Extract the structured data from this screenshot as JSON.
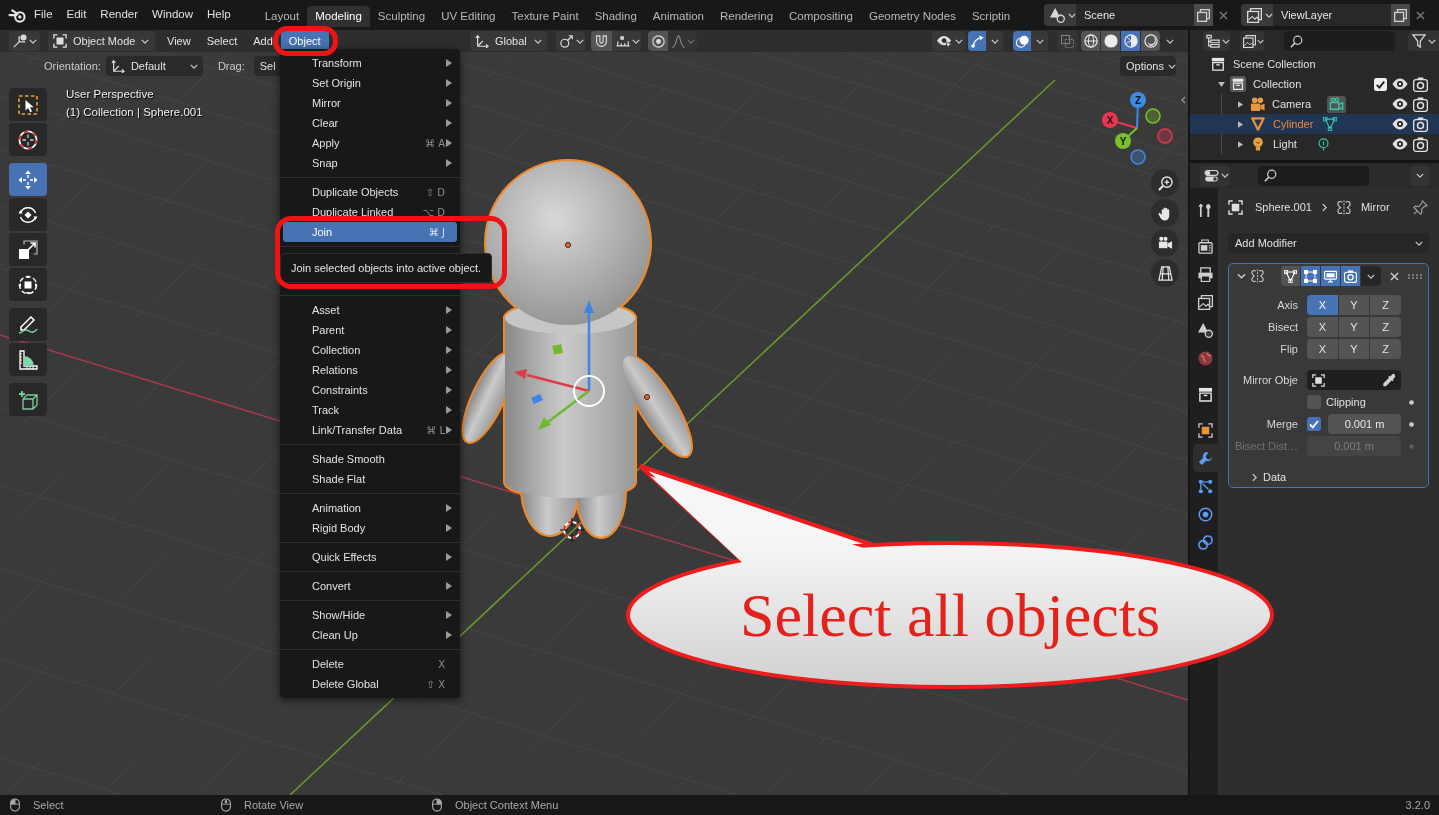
{
  "top_bar": {
    "menus": [
      "File",
      "Edit",
      "Render",
      "Window",
      "Help"
    ],
    "workspaces": [
      {
        "label": "Layout",
        "selected": false
      },
      {
        "label": "Modeling",
        "selected": true
      },
      {
        "label": "Sculpting",
        "selected": false
      },
      {
        "label": "UV Editing",
        "selected": false
      },
      {
        "label": "Texture Paint",
        "selected": false
      },
      {
        "label": "Shading",
        "selected": false
      },
      {
        "label": "Animation",
        "selected": false
      },
      {
        "label": "Rendering",
        "selected": false
      },
      {
        "label": "Compositing",
        "selected": false
      },
      {
        "label": "Geometry Nodes",
        "selected": false
      },
      {
        "label": "Scriptin",
        "selected": false
      }
    ],
    "scene": "Scene",
    "view_layer": "ViewLayer"
  },
  "viewport_header": {
    "mode": "Object Mode",
    "menus": [
      {
        "label": "View",
        "selected": false
      },
      {
        "label": "Select",
        "selected": false
      },
      {
        "label": "Add",
        "selected": false
      },
      {
        "label": "Object",
        "selected": true
      }
    ],
    "transform_orientation": "Global",
    "gizmos": {
      "on": true
    },
    "overlays": {
      "on": true
    },
    "xray": {
      "on": false
    },
    "shading": [
      {
        "kind": "wireframe",
        "selected": false
      },
      {
        "kind": "solid",
        "selected": false
      },
      {
        "kind": "material",
        "selected": true
      },
      {
        "kind": "rendered",
        "selected": false
      }
    ]
  },
  "tool_settings": {
    "orientation_label": "Orientation:",
    "orientation": "Default",
    "drag_label": "Drag:",
    "drag": "Sel",
    "options": "Options"
  },
  "toolbar": {
    "groups": [
      {
        "tools": [
          {
            "kind": "select_box",
            "selected": false
          },
          {
            "kind": "cursor",
            "selected": false
          }
        ]
      },
      {
        "tools": [
          {
            "kind": "move",
            "selected": true
          },
          {
            "kind": "rotate",
            "selected": false
          },
          {
            "kind": "scale",
            "selected": false
          },
          {
            "kind": "transform",
            "selected": false
          }
        ]
      },
      {
        "tools": [
          {
            "kind": "annotate",
            "selected": false
          },
          {
            "kind": "measure",
            "selected": false
          }
        ]
      },
      {
        "tools": [
          {
            "kind": "add_cube",
            "selected": false
          }
        ]
      }
    ]
  },
  "viewport_info": [
    "User Perspective",
    "(1) Collection | Sphere.001"
  ],
  "navigation_gizmo": {
    "axes": [
      {
        "label": "X",
        "color": "#e8364f"
      },
      {
        "label": "Y",
        "color": "#7ac02c"
      },
      {
        "label": "Z",
        "color": "#3c8ce6"
      }
    ]
  },
  "object_menu": {
    "groups": [
      {
        "items": [
          {
            "label": "Transform",
            "submenu": true,
            "selected": false
          },
          {
            "label": "Set Origin",
            "submenu": true,
            "selected": false
          },
          {
            "label": "Mirror",
            "submenu": true,
            "selected": false
          },
          {
            "label": "Clear",
            "submenu": true,
            "selected": false
          },
          {
            "label": "Apply",
            "shortcut": "⌘ A",
            "submenu": true,
            "selected": false
          },
          {
            "label": "Snap",
            "submenu": true,
            "selected": false
          }
        ]
      },
      {
        "items": [
          {
            "label": "Duplicate Objects",
            "shortcut": "⇧ D",
            "submenu": false,
            "selected": false
          },
          {
            "label": "Duplicate Linked",
            "shortcut": "⌥ D",
            "submenu": false,
            "selected": false
          },
          {
            "label": "Join",
            "shortcut": "⌘ J",
            "submenu": false,
            "selected": true
          }
        ]
      },
      {
        "items": [
          {
            "label": "Asset",
            "submenu": true,
            "selected": false
          },
          {
            "label": "Parent",
            "submenu": true,
            "selected": false
          },
          {
            "label": "Collection",
            "submenu": true,
            "selected": false
          },
          {
            "label": "Relations",
            "submenu": true,
            "selected": false
          },
          {
            "label": "Constraints",
            "submenu": true,
            "selected": false
          },
          {
            "label": "Track",
            "submenu": true,
            "selected": false
          },
          {
            "label": "Link/Transfer Data",
            "shortcut": "⌘ L",
            "submenu": true,
            "selected": false
          }
        ]
      },
      {
        "items": [
          {
            "label": "Shade Smooth",
            "submenu": false,
            "selected": false
          },
          {
            "label": "Shade Flat",
            "submenu": false,
            "selected": false
          }
        ]
      },
      {
        "items": [
          {
            "label": "Animation",
            "submenu": true,
            "selected": false
          },
          {
            "label": "Rigid Body",
            "submenu": true,
            "selected": false
          }
        ]
      },
      {
        "items": [
          {
            "label": "Quick Effects",
            "submenu": true,
            "selected": false
          }
        ]
      },
      {
        "items": [
          {
            "label": "Convert",
            "submenu": true,
            "selected": false
          }
        ]
      },
      {
        "items": [
          {
            "label": "Show/Hide",
            "submenu": true,
            "selected": false
          },
          {
            "label": "Clean Up",
            "submenu": true,
            "selected": false
          }
        ]
      },
      {
        "items": [
          {
            "label": "Delete",
            "shortcut": "X",
            "submenu": false,
            "selected": false
          },
          {
            "label": "Delete Global",
            "shortcut": "⇧ X",
            "submenu": false,
            "selected": false
          }
        ]
      }
    ],
    "tooltip": "Join selected objects into active object."
  },
  "callout": "Select all objects",
  "outliner": {
    "tree": [
      {
        "label": "Scene Collection",
        "kind": "scene_collection",
        "children": [
          {
            "label": "Collection",
            "kind": "collection",
            "expanded": true,
            "checked": true,
            "children": [
              {
                "label": "Camera",
                "kind": "camera",
                "expanded": false,
                "selected": false
              },
              {
                "label": "Cylinder",
                "kind": "mesh",
                "expanded": false,
                "selected": true
              },
              {
                "label": "Light",
                "kind": "light",
                "expanded": false,
                "selected": false
              }
            ]
          }
        ]
      }
    ]
  },
  "properties": {
    "tab_groups": [
      {
        "tabs": [
          {
            "kind": "tool",
            "selected": false
          }
        ]
      },
      {
        "tabs": [
          {
            "kind": "render",
            "selected": false
          },
          {
            "kind": "output",
            "selected": false
          },
          {
            "kind": "view_layer",
            "selected": false
          },
          {
            "kind": "scene",
            "selected": false
          },
          {
            "kind": "world",
            "selected": false
          }
        ]
      },
      {
        "tabs": [
          {
            "kind": "collection",
            "selected": false
          }
        ]
      },
      {
        "tabs": [
          {
            "kind": "object",
            "selected": false
          },
          {
            "kind": "modifiers",
            "selected": true
          },
          {
            "kind": "particles",
            "selected": false
          },
          {
            "kind": "physics",
            "selected": false
          },
          {
            "kind": "constraints",
            "selected": false
          }
        ]
      }
    ],
    "breadcrumb": {
      "object": "Sphere.001",
      "modifier": "Mirror"
    },
    "add_modifier": "Add Modifier",
    "modifier": {
      "expanded": true,
      "toggles": [
        {
          "kind": "on_cage",
          "on": false
        },
        {
          "kind": "edit_mode",
          "on": true
        },
        {
          "kind": "viewport",
          "on": true
        },
        {
          "kind": "render",
          "on": true
        }
      ],
      "axis_rows": [
        {
          "label": "Axis",
          "buttons": [
            {
              "label": "X",
              "selected": true
            },
            {
              "label": "Y",
              "selected": false
            },
            {
              "label": "Z",
              "selected": false
            }
          ]
        },
        {
          "label": "Bisect",
          "buttons": [
            {
              "label": "X",
              "selected": false
            },
            {
              "label": "Y",
              "selected": false
            },
            {
              "label": "Z",
              "selected": false
            }
          ]
        },
        {
          "label": "Flip",
          "buttons": [
            {
              "label": "X",
              "selected": false
            },
            {
              "label": "Y",
              "selected": false
            },
            {
              "label": "Z",
              "selected": false
            }
          ]
        }
      ],
      "mirror_object": {
        "label": "Mirror Obje"
      },
      "clipping": {
        "label": "Clipping",
        "checked": false
      },
      "merge": {
        "label": "Merge",
        "checked": true,
        "value": "0.001 m"
      },
      "bisect_distance": {
        "label": "Bisect Dist…",
        "value": "0.001 m",
        "disabled": true
      },
      "data_panel": {
        "label": "Data",
        "expanded": false
      }
    }
  },
  "status_bar": {
    "hints": [
      {
        "kind": "left_mouse",
        "label": "Select"
      },
      {
        "kind": "middle_mouse",
        "label": "Rotate View"
      },
      {
        "kind": "right_mouse",
        "label": "Object Context Menu"
      }
    ],
    "version": "3.2.0"
  }
}
